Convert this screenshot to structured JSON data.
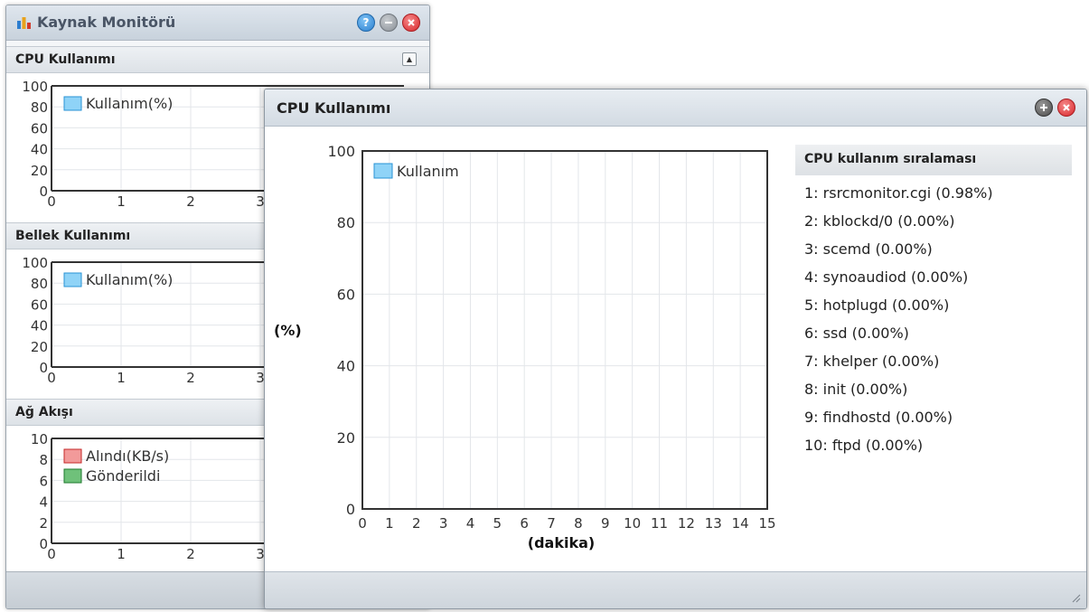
{
  "back_window": {
    "title": "Kaynak Monitörü",
    "sections": [
      {
        "title": "CPU Kullanımı",
        "y_ticks": [
          "100",
          "80",
          "60",
          "40",
          "20",
          "0"
        ],
        "x_ticks": [
          "0",
          "1",
          "2",
          "3"
        ],
        "legend": [
          {
            "label": "Kullanım(%)",
            "color": "#8fd3f7",
            "border": "#2a93d5"
          }
        ]
      },
      {
        "title": "Bellek Kullanımı",
        "y_ticks": [
          "100",
          "80",
          "60",
          "40",
          "20",
          "0"
        ],
        "x_ticks": [
          "0",
          "1",
          "2",
          "3"
        ],
        "legend": [
          {
            "label": "Kullanım(%)",
            "color": "#8fd3f7",
            "border": "#2a93d5"
          }
        ]
      },
      {
        "title": "Ağ Akışı",
        "y_ticks": [
          "10",
          "8",
          "6",
          "4",
          "2",
          "0"
        ],
        "x_ticks": [
          "0",
          "1",
          "2",
          "3"
        ],
        "legend": [
          {
            "label": "Alındı(KB/s)",
            "color": "#f29a9a",
            "border": "#c62828"
          },
          {
            "label": "Gönderildi",
            "color": "#6fc17a",
            "border": "#1e7a2d"
          }
        ]
      }
    ]
  },
  "front_window": {
    "title": "CPU Kullanımı",
    "ranking_title": "CPU kullanım sıralaması",
    "ranking": [
      "1: rsrcmonitor.cgi (0.98%)",
      "2: kblockd/0 (0.00%)",
      "3: scemd (0.00%)",
      "4: synoaudiod (0.00%)",
      "5: hotplugd (0.00%)",
      "6: ssd (0.00%)",
      "7: khelper (0.00%)",
      "8: init (0.00%)",
      "9: findhostd (0.00%)",
      "10: ftpd (0.00%)"
    ]
  },
  "chart_data": {
    "type": "line",
    "title": "",
    "xlabel": "(dakika)",
    "ylabel": "(%)",
    "x_ticks": [
      "0",
      "1",
      "2",
      "3",
      "4",
      "5",
      "6",
      "7",
      "8",
      "9",
      "10",
      "11",
      "12",
      "13",
      "14",
      "15"
    ],
    "y_ticks": [
      "100",
      "80",
      "60",
      "40",
      "20",
      "0"
    ],
    "xlim": [
      0,
      15
    ],
    "ylim": [
      0,
      100
    ],
    "grid": true,
    "legend_position": "top-left",
    "series": [
      {
        "name": "Kullanım",
        "values": [],
        "color": "#8fd3f7"
      }
    ]
  },
  "colors": {
    "legend_blue_fill": "#8fd3f7",
    "legend_blue_border": "#2a93d5",
    "grid": "#e3e6ea",
    "axis": "#333333"
  },
  "icons": {
    "app_logo": "bar-chart-icon",
    "help": "question-icon",
    "minimize": "minus-icon",
    "close": "close-icon",
    "plus": "plus-icon",
    "collapse": "triangle-up-icon",
    "resize": "resize-grip-icon"
  }
}
